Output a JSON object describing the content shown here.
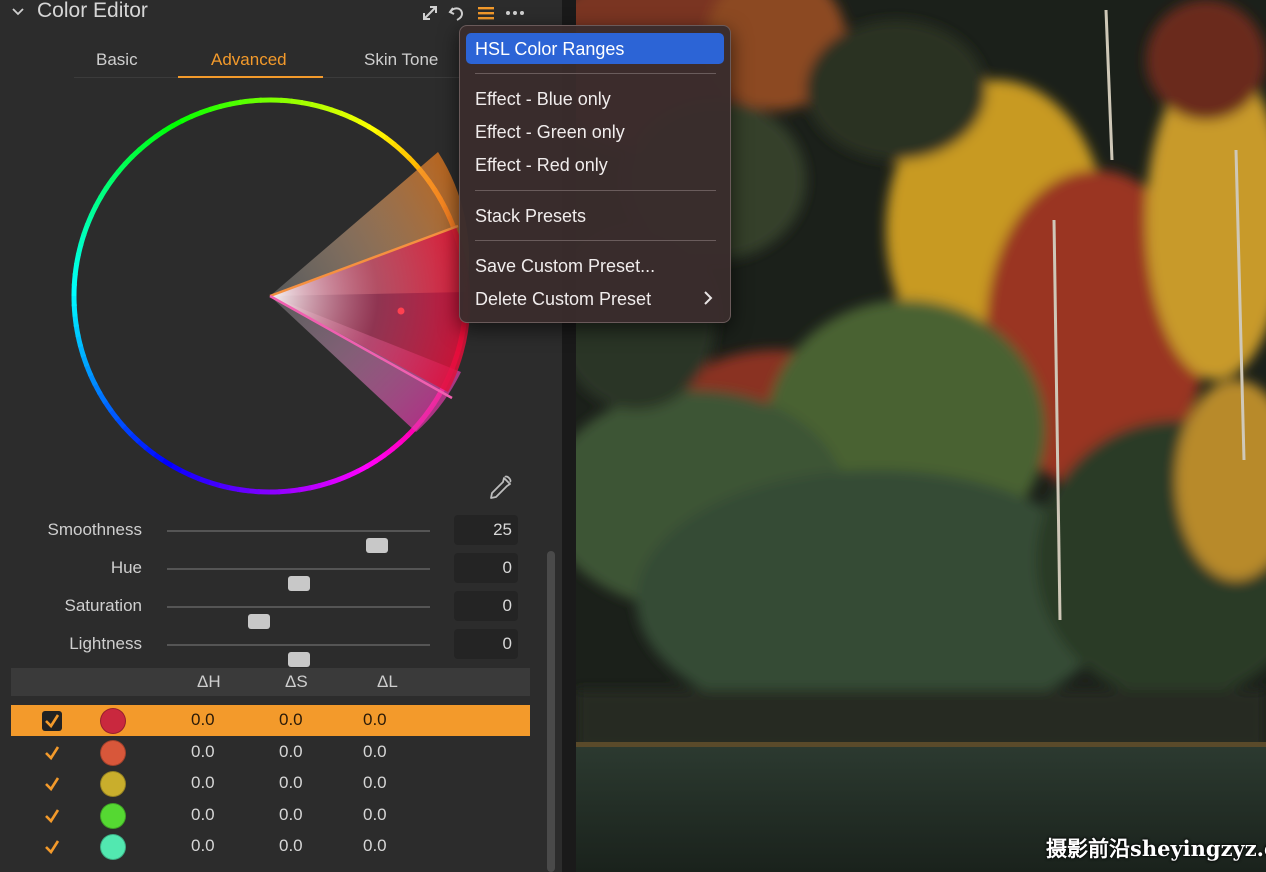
{
  "header": {
    "title": "Color Editor",
    "icons": [
      "chevron-down-icon",
      "expand-icon",
      "reset-icon",
      "presets-menu-icon",
      "more-icon"
    ]
  },
  "tabs": [
    {
      "label": "Basic",
      "active": false
    },
    {
      "label": "Advanced",
      "active": true
    },
    {
      "label": "Skin Tone",
      "active": false
    }
  ],
  "sliders": [
    {
      "label": "Smoothness",
      "value": "25",
      "level": 0.8
    },
    {
      "label": "Hue",
      "value": "0",
      "level": 0.5
    },
    {
      "label": "Saturation",
      "value": "0",
      "level": 0.35
    },
    {
      "label": "Lightness",
      "value": "0",
      "level": 0.5
    }
  ],
  "table": {
    "headers": [
      "ΔH",
      "ΔS",
      "ΔL"
    ],
    "rows": [
      {
        "color": "#c9283e",
        "dh": "0.0",
        "ds": "0.0",
        "dl": "0.0",
        "selected": true
      },
      {
        "color": "#d8573a",
        "dh": "0.0",
        "ds": "0.0",
        "dl": "0.0",
        "selected": false
      },
      {
        "color": "#c9ae2c",
        "dh": "0.0",
        "ds": "0.0",
        "dl": "0.0",
        "selected": false
      },
      {
        "color": "#55d832",
        "dh": "0.0",
        "ds": "0.0",
        "dl": "0.0",
        "selected": false
      },
      {
        "color": "#52e8b0",
        "dh": "0.0",
        "ds": "0.0",
        "dl": "0.0",
        "selected": false
      }
    ]
  },
  "menu": {
    "items": [
      {
        "label": "HSL Color Ranges",
        "highlighted": true
      },
      {
        "label": "Effect - Blue only"
      },
      {
        "label": "Effect - Green only"
      },
      {
        "label": "Effect - Red only"
      },
      {
        "label": "Stack Presets"
      },
      {
        "label": "Save Custom Preset..."
      },
      {
        "label": "Delete Custom Preset",
        "submenu": true
      }
    ]
  },
  "watermark": "摄影前沿sheyingzyz.com",
  "colors": {
    "accent": "#f39a2b",
    "menu_highlight": "#2c64d6",
    "panel_bg": "#2c2c2c"
  }
}
